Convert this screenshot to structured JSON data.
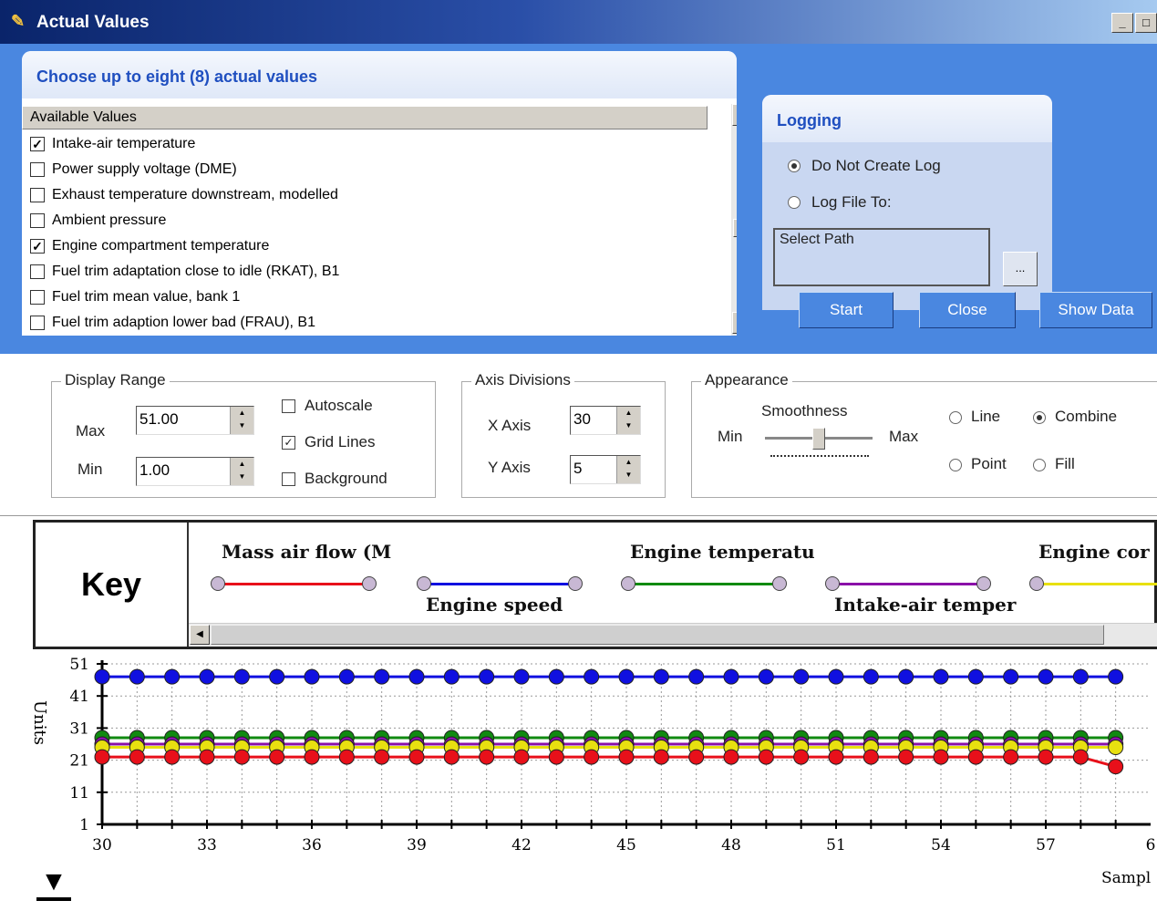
{
  "window": {
    "title": "Actual Values",
    "buttons": [
      "_",
      "□"
    ]
  },
  "choose_panel": {
    "heading": "Choose up to eight (8) actual values",
    "list_header": "Available Values",
    "items": [
      {
        "label": "Intake-air temperature",
        "checked": true
      },
      {
        "label": "Power supply voltage (DME)",
        "checked": false
      },
      {
        "label": "Exhaust temperature downstream, modelled",
        "checked": false
      },
      {
        "label": "Ambient pressure",
        "checked": false
      },
      {
        "label": "Engine compartment temperature",
        "checked": true
      },
      {
        "label": "Fuel trim adaptation close to idle (RKAT), B1",
        "checked": false
      },
      {
        "label": "Fuel trim mean value, bank 1",
        "checked": false
      },
      {
        "label": "Fuel trim adaption lower bad (FRAU), B1",
        "checked": false
      }
    ]
  },
  "logging": {
    "heading": "Logging",
    "option_no_log": "Do Not Create Log",
    "option_log_to": "Log File To:",
    "selected": "Do Not Create Log",
    "path_placeholder": "Select Path",
    "browse_label": "..."
  },
  "actions": {
    "start": "Start",
    "close": "Close",
    "show_data": "Show Data"
  },
  "display_range": {
    "legend": "Display Range",
    "max_label": "Max",
    "max_value": "51.00",
    "min_label": "Min",
    "min_value": "1.00",
    "autoscale_label": "Autoscale",
    "autoscale": false,
    "grid_label": "Grid Lines",
    "grid": true,
    "background_label": "Background",
    "background": false
  },
  "axis_divisions": {
    "legend": "Axis Divisions",
    "x_label": "X Axis",
    "x_value": "30",
    "y_label": "Y Axis",
    "y_value": "5"
  },
  "appearance": {
    "legend": "Appearance",
    "smoothness_label": "Smoothness",
    "min_label": "Min",
    "max_label": "Max",
    "smoothness_level": 0.5,
    "line_label": "Line",
    "combine_label": "Combine",
    "point_label": "Point",
    "fill_label": "Fill",
    "selected": "Combine"
  },
  "key": {
    "title": "Key",
    "series": [
      {
        "name": "Mass air flow (M",
        "color": "#e8101a"
      },
      {
        "name": "Engine speed",
        "color": "#1010e0"
      },
      {
        "name": "Engine temperatu",
        "color": "#108a10"
      },
      {
        "name": "Intake-air temper",
        "color": "#8a10a8"
      },
      {
        "name": "Engine cor",
        "color": "#e8e010"
      }
    ]
  },
  "chart_data": {
    "type": "line",
    "ylabel": "Units",
    "xlabel": "Sampl",
    "ylim": [
      1,
      51
    ],
    "y_ticks": [
      "51",
      "41",
      "31",
      "21",
      "11",
      "1"
    ],
    "x_ticks": [
      "30",
      "33",
      "36",
      "39",
      "42",
      "45",
      "48",
      "51",
      "54",
      "57",
      "6"
    ],
    "x": [
      30,
      31,
      32,
      33,
      34,
      35,
      36,
      37,
      38,
      39,
      40,
      41,
      42,
      43,
      44,
      45,
      46,
      47,
      48,
      49,
      50,
      51,
      52,
      53,
      54,
      55,
      56,
      57,
      58,
      59
    ],
    "series": [
      {
        "name": "Engine speed",
        "color": "#1010e0",
        "values": [
          47,
          47,
          47,
          47,
          47,
          47,
          47,
          47,
          47,
          47,
          47,
          47,
          47,
          47,
          47,
          47,
          47,
          47,
          47,
          47,
          47,
          47,
          47,
          47,
          47,
          47,
          47,
          47,
          47,
          47
        ]
      },
      {
        "name": "Engine temperatu",
        "color": "#108a10",
        "values": [
          28,
          28,
          28,
          28,
          28,
          28,
          28,
          28,
          28,
          28,
          28,
          28,
          28,
          28,
          28,
          28,
          28,
          28,
          28,
          28,
          28,
          28,
          28,
          28,
          28,
          28,
          28,
          28,
          28,
          28
        ]
      },
      {
        "name": "Intake-air temper",
        "color": "#8a10a8",
        "values": [
          26,
          26,
          26,
          26,
          26,
          26,
          26,
          26,
          26,
          26,
          26,
          26,
          26,
          26,
          26,
          26,
          26,
          26,
          26,
          26,
          26,
          26,
          26,
          26,
          26,
          26,
          26,
          26,
          26,
          26
        ]
      },
      {
        "name": "Engine cor",
        "color": "#e8e010",
        "values": [
          25,
          25,
          25,
          25,
          25,
          25,
          25,
          25,
          25,
          25,
          25,
          25,
          25,
          25,
          25,
          25,
          25,
          25,
          25,
          25,
          25,
          25,
          25,
          25,
          25,
          25,
          25,
          25,
          25,
          25
        ]
      },
      {
        "name": "Mass air flow (M",
        "color": "#e8101a",
        "values": [
          22,
          22,
          22,
          22,
          22,
          22,
          22,
          22,
          22,
          22,
          22,
          22,
          22,
          22,
          22,
          22,
          22,
          22,
          22,
          22,
          22,
          22,
          22,
          22,
          22,
          22,
          22,
          22,
          22,
          19
        ]
      }
    ]
  },
  "bottom": {
    "scroll_down_icon": "arrow-down-bar-icon"
  }
}
